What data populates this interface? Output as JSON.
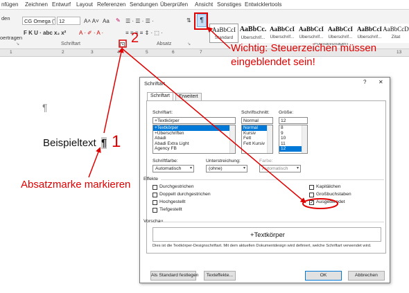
{
  "menubar": {
    "tabs": [
      "nfügen",
      "Zeichnen",
      "Entwurf",
      "Layout",
      "Referenzen",
      "Sendungen",
      "Überprüfen",
      "Ansicht",
      "Sonstiges",
      "Entwicklertools"
    ]
  },
  "ribbon": {
    "left_labels": [
      "den",
      "oertragen"
    ],
    "font_name": "CG Omega (Te",
    "font_size": "12",
    "grow_glyphs": "A˄ A˅",
    "case_glyph": "Aa",
    "format_glyphs": "F  K  U · abc  x₂  x²",
    "color_glyphs": "A ·  ✐ ·  A ·",
    "para_glyphs": "☰ · ☰ · ☰ ·",
    "align_glyphs": "≡ ≡ ≡ ≡  ⇕ ·  ⬚ ·",
    "sort_glyph": "⇅",
    "pilcrow": "¶",
    "group_schriftart": "Schriftart",
    "group_absatz": "Absatz",
    "group_formatvorlagen": "Formatvorlagen",
    "styles": [
      {
        "preview": "AaBbCcI",
        "name": "Standard"
      },
      {
        "preview": "AaBbCc.",
        "name": "Überschrif..."
      },
      {
        "preview": "AaBbCcI",
        "name": "Überschrif..."
      },
      {
        "preview": "AaBbCcI",
        "name": "Überschrif..."
      },
      {
        "preview": "AaBbCcI",
        "name": "Überschrif..."
      },
      {
        "preview": "AaBbCcI",
        "name": "Überschrif..."
      },
      {
        "preview": "AaBbCcD",
        "name": "Zitat"
      }
    ]
  },
  "ruler": {
    "numbers": [
      "1",
      "2",
      "3",
      "4",
      "5",
      "6",
      "7",
      "13"
    ]
  },
  "document": {
    "pilcrow_mark": "¶",
    "text": "Beispieltext",
    "pilcrow_selected": "¶"
  },
  "annotations": {
    "one": "1",
    "two": "2",
    "three": "3",
    "note_line1": "Wichtig: Steuerzeichen müssen",
    "note_line2": "eingeblendet sein!",
    "absatzmarke": "Absatzmarke markieren",
    "color": "#e00000"
  },
  "dialog": {
    "title": "Schriftart",
    "help": "?",
    "close": "✕",
    "tabs": [
      "Schriftart",
      "Erweitert"
    ],
    "font_label": "Schriftart:",
    "font_value": "+Textkörper",
    "font_list": [
      "+Textkörper",
      "+Überschriften",
      "Abadi",
      "Abadi Extra Light",
      "Agency FB"
    ],
    "style_label": "Schriftschnitt:",
    "style_value": "Normal",
    "style_list": [
      "Normal",
      "Kursiv",
      "Fett",
      "Fett Kursiv"
    ],
    "size_label": "Größe:",
    "size_value": "12",
    "size_list": [
      "8",
      "9",
      "10",
      "11",
      "12"
    ],
    "color_label": "Schriftfarbe:",
    "color_value": "Automatisch",
    "underline_label": "Unterstreichung:",
    "underline_value": "(ohne)",
    "ul_color_label": "Farbe:",
    "ul_color_value": "Automatisch",
    "effects_label": "Effekte",
    "effects_left": [
      "Durchgestrichen",
      "Doppelt durchgestrichen",
      "Hochgestellt",
      "Tiefgestellt"
    ],
    "effects_right": [
      "Kapitälchen",
      "Großbuchstaben",
      "Ausgeblendet"
    ],
    "checked_effect": "Ausgeblendet",
    "preview_label": "Vorschau",
    "preview_text": "+Textkörper",
    "info_text": "Dies ist die Textkörper-Designschriftart. Mit dem aktuellen Dokumentdesign wird definiert, welche Schriftart verwendet wird.",
    "btn_default": "Als Standard festlegen",
    "btn_effects": "Texteffekte...",
    "btn_ok": "OK",
    "btn_cancel": "Abbrechen"
  }
}
